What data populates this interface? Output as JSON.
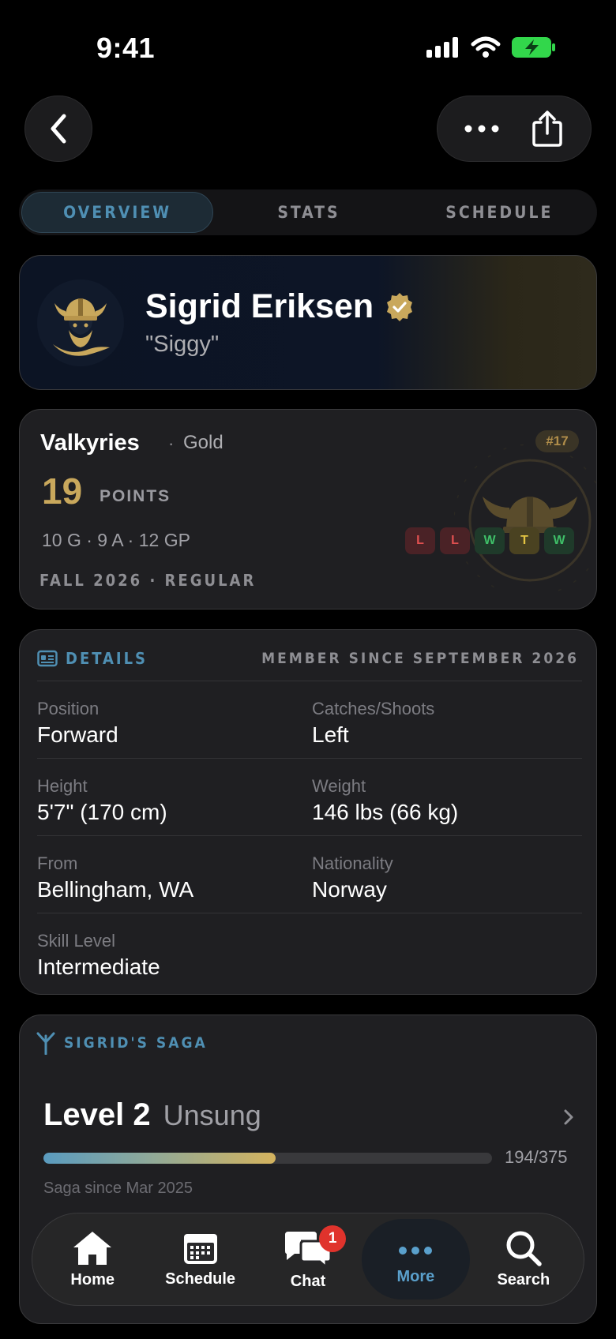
{
  "status": {
    "time": "9:41"
  },
  "tabs": [
    {
      "label": "OVERVIEW",
      "active": true
    },
    {
      "label": "STATS",
      "active": false
    },
    {
      "label": "SCHEDULE",
      "active": false
    }
  ],
  "player": {
    "name": "Sigrid Eriksen",
    "nickname": "\"Siggy\"",
    "verified": true
  },
  "team": {
    "name": "Valkyries",
    "separator": "·",
    "tier": "Gold",
    "rank": "#17",
    "points": "19",
    "points_label": "POINTS",
    "stat_line": "10 G · 9 A · 12 GP",
    "season": "FALL 2026 · REGULAR",
    "form": [
      "L",
      "L",
      "W",
      "T",
      "W"
    ]
  },
  "details": {
    "title": "DETAILS",
    "member_since": "MEMBER SINCE SEPTEMBER 2026",
    "fields": [
      {
        "label": "Position",
        "value": "Forward"
      },
      {
        "label": "Catches/Shoots",
        "value": "Left"
      },
      {
        "label": "Height",
        "value": "5'7\" (170 cm)"
      },
      {
        "label": "Weight",
        "value": "146 lbs (66 kg)"
      },
      {
        "label": "From",
        "value": "Bellingham, WA"
      },
      {
        "label": "Nationality",
        "value": "Norway"
      },
      {
        "label": "Skill Level",
        "value": "Intermediate"
      }
    ]
  },
  "saga": {
    "title": "SIGRID'S SAGA",
    "level": "Level 2",
    "level_name": "Unsung",
    "progress_current": 194,
    "progress_max": 375,
    "progress_text": "194/375",
    "since": "Saga since Mar 2025"
  },
  "tabbar": {
    "items": [
      {
        "label": "Home",
        "icon": "house-icon"
      },
      {
        "label": "Schedule",
        "icon": "calendar-icon"
      },
      {
        "label": "Chat",
        "icon": "chat-icon",
        "badge": "1"
      },
      {
        "label": "More",
        "icon": "ellipsis-icon",
        "active": true
      },
      {
        "label": "Search",
        "icon": "search-icon"
      }
    ]
  },
  "colors": {
    "accent": "#4f8fb3",
    "gold": "#c9a85c",
    "loss": "#e05050",
    "win": "#3fbf68",
    "tie": "#e3c443",
    "notification": "#e0332c"
  }
}
